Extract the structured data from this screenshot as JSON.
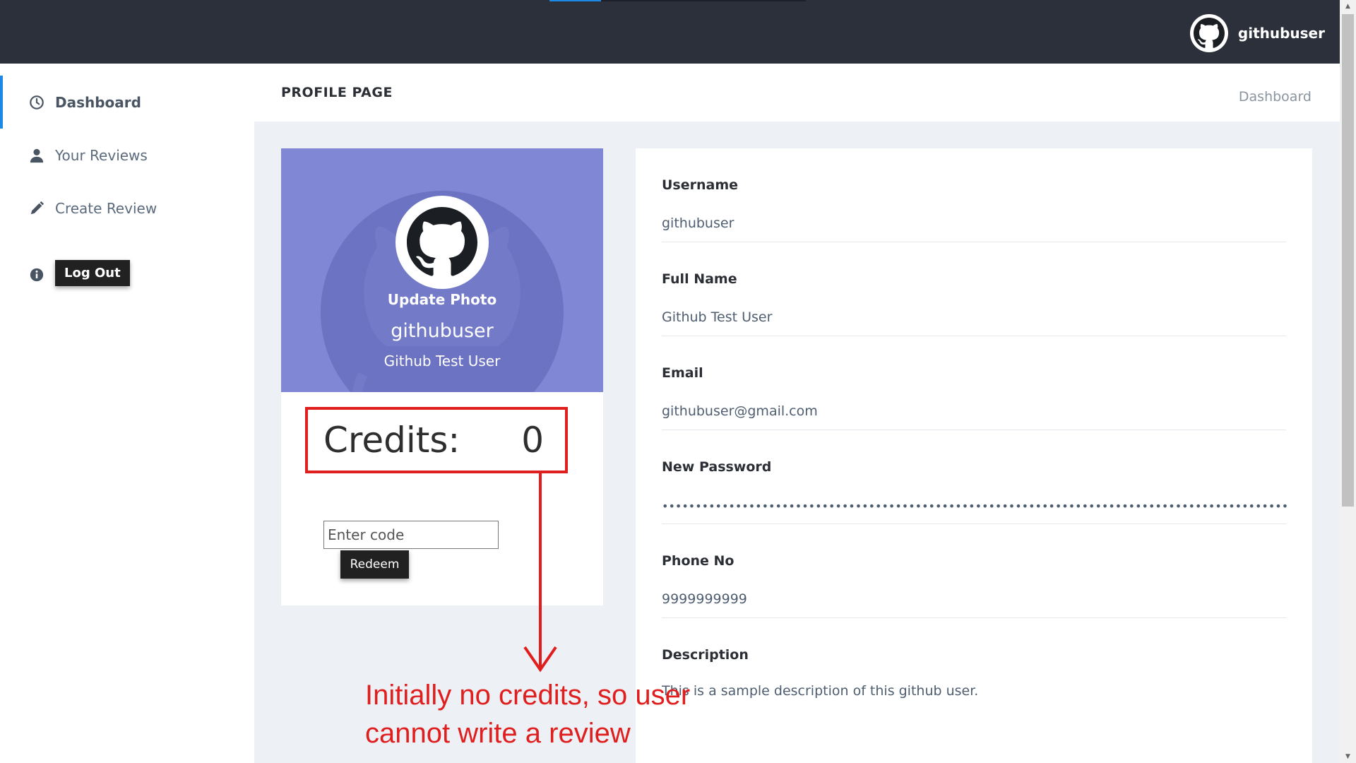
{
  "topbar": {
    "username": "githubuser"
  },
  "sidebar": {
    "items": [
      {
        "label": "Dashboard",
        "icon": "clock-icon"
      },
      {
        "label": "Your Reviews",
        "icon": "user-icon"
      },
      {
        "label": "Create Review",
        "icon": "pencil-icon"
      }
    ],
    "logout_label": "Log Out"
  },
  "header": {
    "title": "PROFILE PAGE",
    "breadcrumb": "Dashboard"
  },
  "profile": {
    "update_photo": "Update Photo",
    "username": "githubuser",
    "full_name": "Github Test User",
    "credits_label": "Credits:",
    "credits_value": "0",
    "code_placeholder": "Enter code",
    "redeem_label": "Redeem"
  },
  "details": {
    "fields": [
      {
        "label": "Username",
        "value": "githubuser"
      },
      {
        "label": "Full Name",
        "value": "Github Test User"
      },
      {
        "label": "Email",
        "value": "githubuser@gmail.com"
      },
      {
        "label": "New Password",
        "value": "••••••••••••••••••••••••••••••••••••••••••••••••••••••••••••••••••••••••••••••••••••••••••••••"
      },
      {
        "label": "Phone No",
        "value": "9999999999"
      },
      {
        "label": "Description",
        "value": "This is a sample description of this github user."
      }
    ]
  },
  "annotation": {
    "line1": "Initially no credits, so user",
    "line2": "cannot write a review",
    "color": "#e01e1e"
  },
  "colors": {
    "accent": "#1e88e5",
    "banner": "#8088d6",
    "topbar": "#2c303b"
  }
}
